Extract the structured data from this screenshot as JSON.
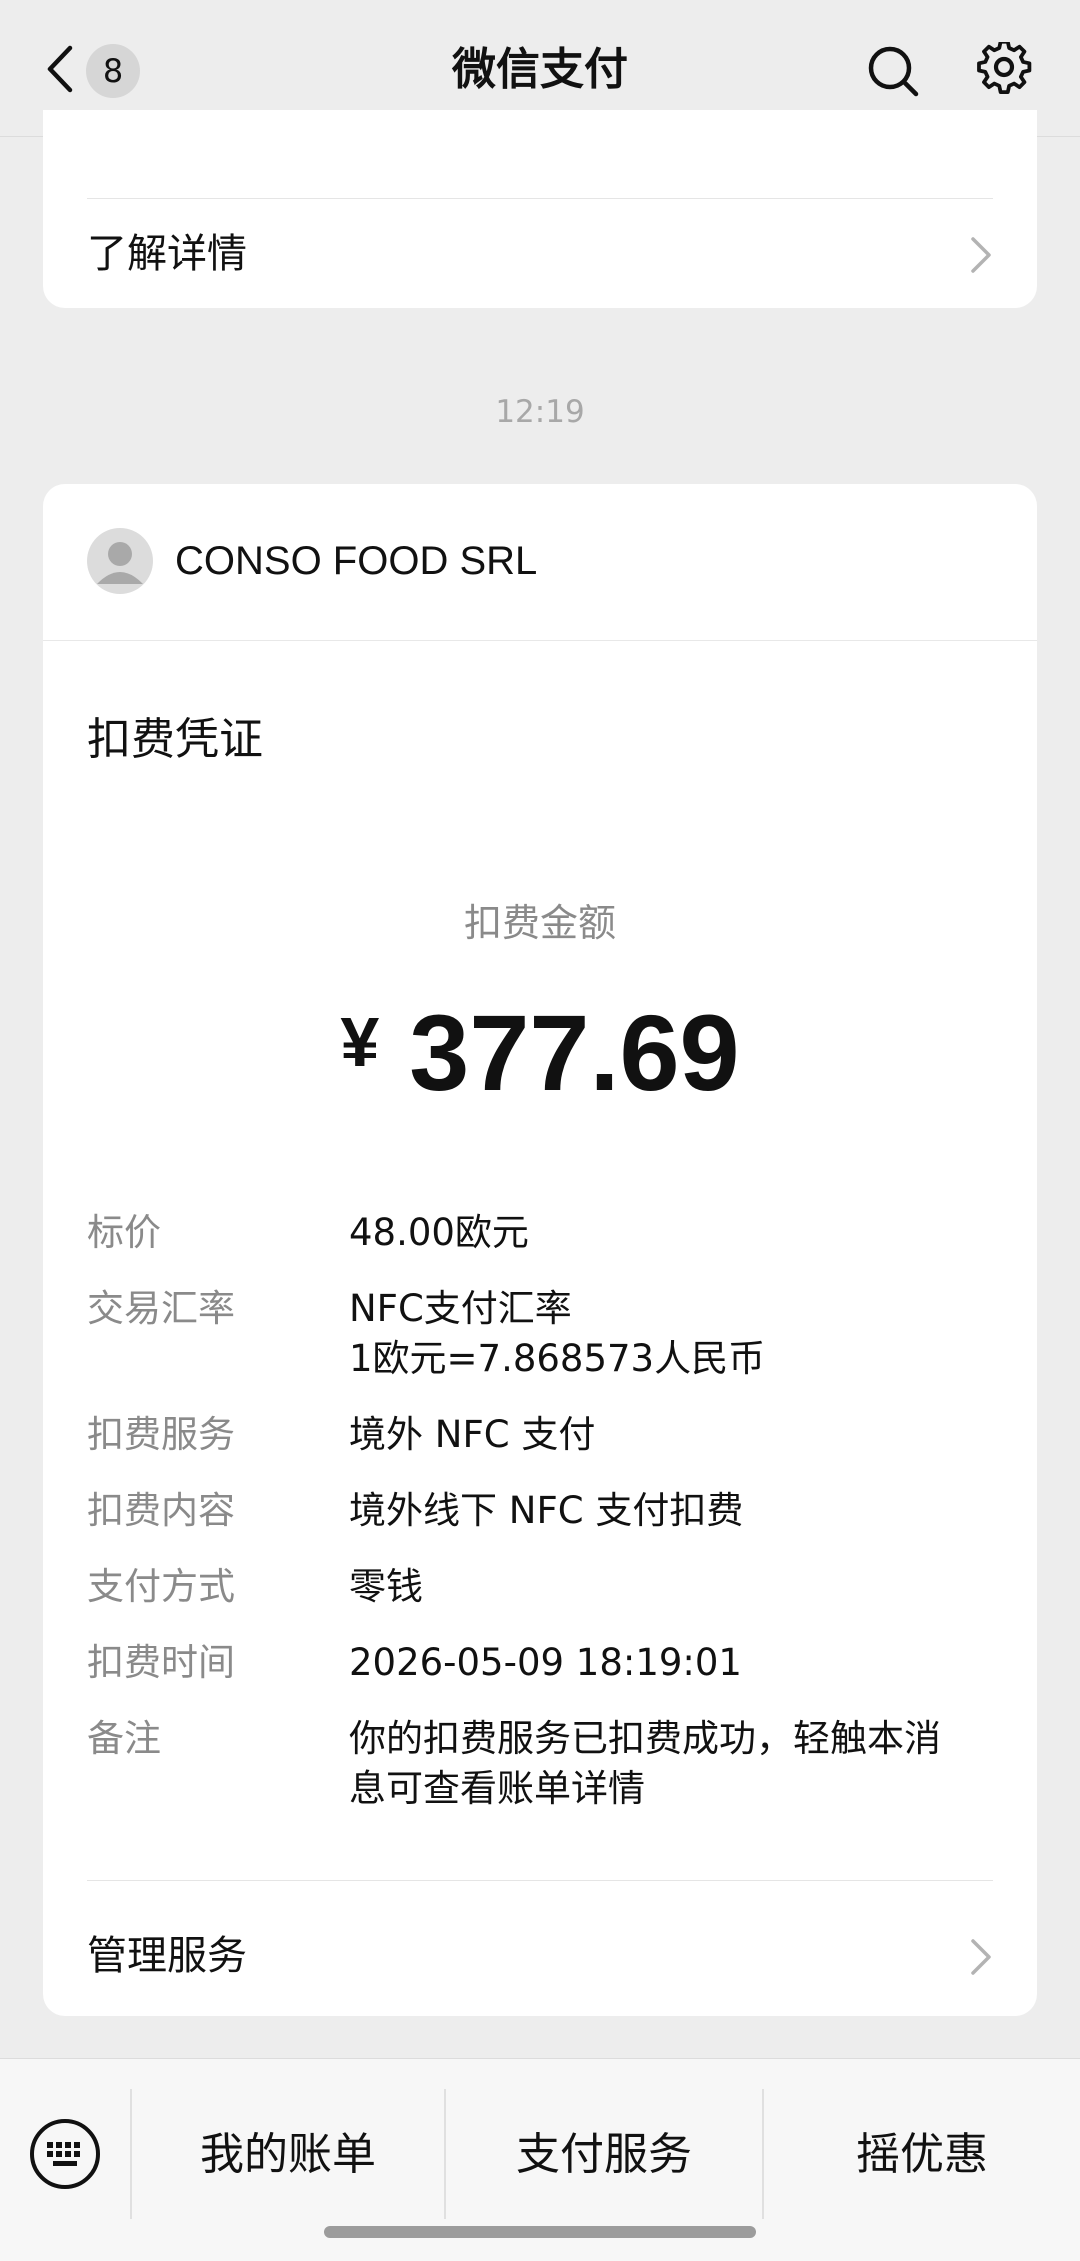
{
  "header": {
    "unread_count": "8",
    "title": "微信支付"
  },
  "top_card": {
    "link_label": "了解详情"
  },
  "message_time": "12:19",
  "receipt": {
    "merchant_name": "CONSO FOOD SRL",
    "title": "扣费凭证",
    "amount_label": "扣费金额",
    "currency_symbol": "¥",
    "amount": "377.69",
    "details": [
      {
        "label": "标价",
        "value": "48.00欧元"
      },
      {
        "label": "交易汇率",
        "value": "NFC支付汇率\n1欧元=7.868573人民币"
      },
      {
        "label": "扣费服务",
        "value": "境外 NFC 支付"
      },
      {
        "label": "扣费内容",
        "value": "境外线下 NFC 支付扣费"
      },
      {
        "label": "支付方式",
        "value": "零钱"
      },
      {
        "label": "扣费时间",
        "value": "2026-05-09 18:19:01"
      },
      {
        "label": "备注",
        "value": "你的扣费服务已扣费成功，轻触本消\n息可查看账单详情"
      }
    ],
    "manage_label": "管理服务"
  },
  "bottom_menu": {
    "items": [
      "我的账单",
      "支付服务",
      "摇优惠"
    ]
  },
  "icons": [
    "back-icon",
    "search-icon",
    "gear-icon",
    "chevron-right-icon",
    "avatar-icon",
    "keyboard-icon"
  ]
}
